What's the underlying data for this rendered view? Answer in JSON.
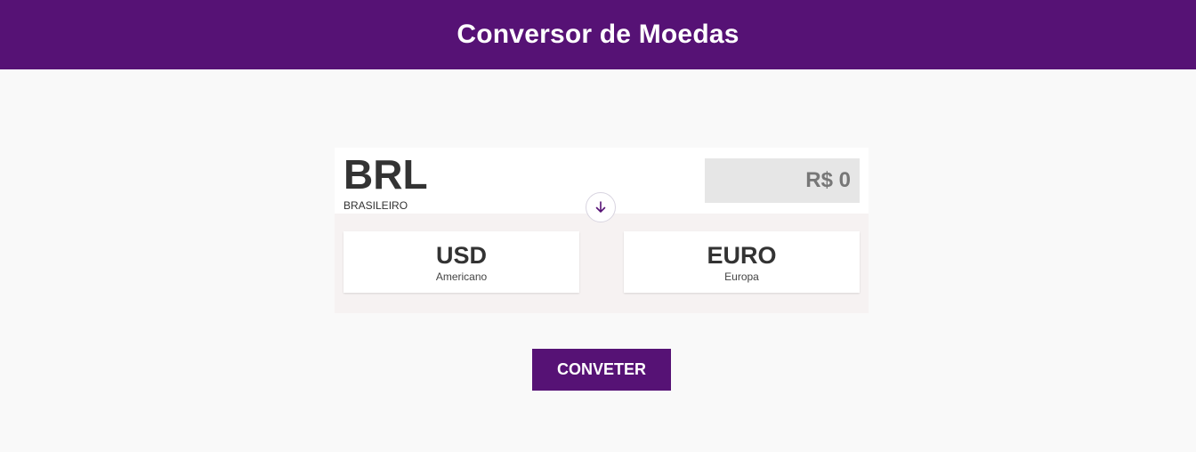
{
  "header": {
    "title": "Conversor de Moedas"
  },
  "source": {
    "code": "BRL",
    "name": "BRASILEIRO",
    "amount": "R$ 0"
  },
  "targets": [
    {
      "code": "USD",
      "name": "Americano"
    },
    {
      "code": "EURO",
      "name": "Europa"
    }
  ],
  "actions": {
    "convert_label": "CONVETER"
  },
  "icons": {
    "swap": "arrow-down-icon"
  },
  "colors": {
    "brand": "#561275",
    "amount_bg": "#e6e6e6",
    "panel_bg": "#f6f2f2"
  }
}
